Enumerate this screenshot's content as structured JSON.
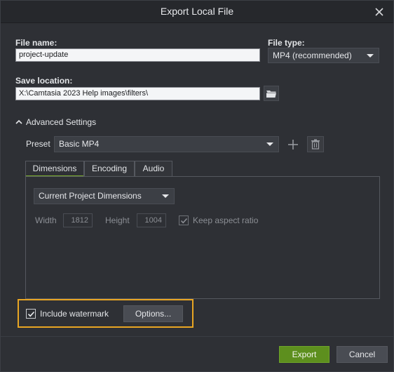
{
  "window": {
    "title": "Export Local File"
  },
  "file_name": {
    "label": "File name:",
    "value": "project-update"
  },
  "file_type": {
    "label": "File type:",
    "selected": "MP4 (recommended)"
  },
  "save_location": {
    "label": "Save location:",
    "value": "X:\\Camtasia 2023 Help images\\filters\\"
  },
  "advanced": {
    "toggle_label": "Advanced Settings",
    "preset_label": "Preset",
    "preset_selected": "Basic MP4",
    "tabs": [
      {
        "label": "Dimensions"
      },
      {
        "label": "Encoding"
      },
      {
        "label": "Audio"
      }
    ],
    "dimensions": {
      "mode_selected": "Current Project Dimensions",
      "width_label": "Width",
      "width_value": "1812",
      "height_label": "Height",
      "height_value": "1004",
      "keep_aspect_label": "Keep aspect ratio"
    }
  },
  "watermark": {
    "label": "Include watermark",
    "options_label": "Options..."
  },
  "footer": {
    "export_label": "Export",
    "cancel_label": "Cancel"
  },
  "colors": {
    "accent": "#5d8f1e",
    "highlight": "#e8a523",
    "tab_underline": "#7cae2e"
  }
}
